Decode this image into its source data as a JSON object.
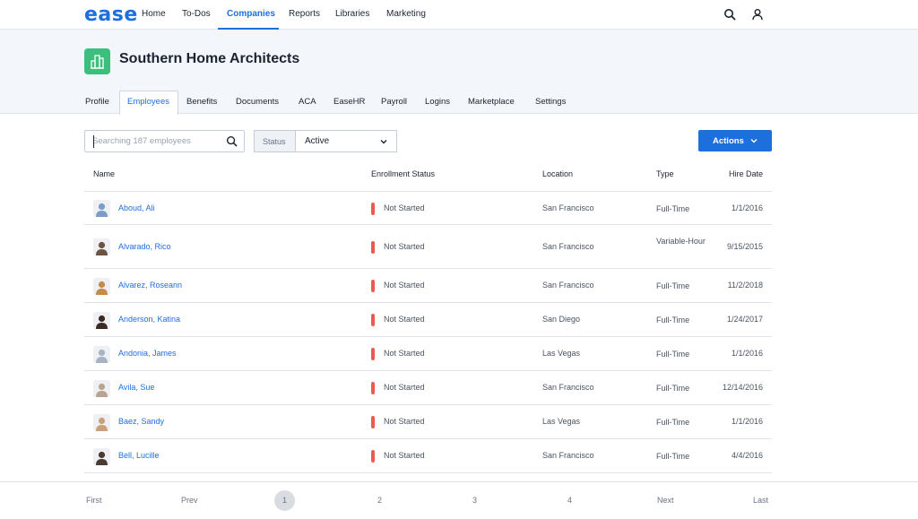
{
  "app": {
    "logo": "ease",
    "nav": [
      "Home",
      "To-Dos",
      "Companies",
      "Reports",
      "Libraries",
      "Marketing"
    ],
    "active_nav": "Companies"
  },
  "company": {
    "name": "Southern Home Architects",
    "tabs": [
      "Profile",
      "Employees",
      "Benefits",
      "Documents",
      "ACA",
      "EaseHR",
      "Payroll",
      "Logins",
      "Marketplace",
      "Settings"
    ],
    "active_tab": "Employees"
  },
  "toolbar": {
    "search_placeholder": "Searching 187 employees",
    "status_label": "Status",
    "status_value": "Active",
    "actions_label": "Actions"
  },
  "table": {
    "headers": {
      "name": "Name",
      "enrollment": "Enrollment Status",
      "location": "Location",
      "type": "Type",
      "hire_date": "Hire Date"
    },
    "rows": [
      {
        "name": "Aboud, Ali",
        "status": "Not Started",
        "location": "San Francisco",
        "type": "Full-Time",
        "hire_date": "1/1/2016"
      },
      {
        "name": "Alvarado, Rico",
        "status": "Not Started",
        "location": "San Francisco",
        "type": "Variable-Hour",
        "hire_date": "9/15/2015"
      },
      {
        "name": "Alvarez, Roseann",
        "status": "Not Started",
        "location": "San Francisco",
        "type": "Full-Time",
        "hire_date": "11/2/2018"
      },
      {
        "name": "Anderson, Katina",
        "status": "Not Started",
        "location": "San Diego",
        "type": "Full-Time",
        "hire_date": "1/24/2017"
      },
      {
        "name": "Andonia, James",
        "status": "Not Started",
        "location": "Las Vegas",
        "type": "Full-Time",
        "hire_date": "1/1/2016"
      },
      {
        "name": "Avila, Sue",
        "status": "Not Started",
        "location": "San Francisco",
        "type": "Full-Time",
        "hire_date": "12/14/2016"
      },
      {
        "name": "Baez, Sandy",
        "status": "Not Started",
        "location": "Las Vegas",
        "type": "Full-Time",
        "hire_date": "1/1/2016"
      },
      {
        "name": "Bell, Lucille",
        "status": "Not Started",
        "location": "San Francisco",
        "type": "Full-Time",
        "hire_date": "4/4/2016"
      }
    ]
  },
  "pager": {
    "first": "First",
    "prev": "Prev",
    "pages": [
      "1",
      "2",
      "3",
      "4"
    ],
    "current": "1",
    "next": "Next",
    "last": "Last"
  },
  "colors": {
    "accent": "#1d6fdc",
    "status_not_started": "#ee5a52",
    "company_icon": "#3cbf7c"
  }
}
